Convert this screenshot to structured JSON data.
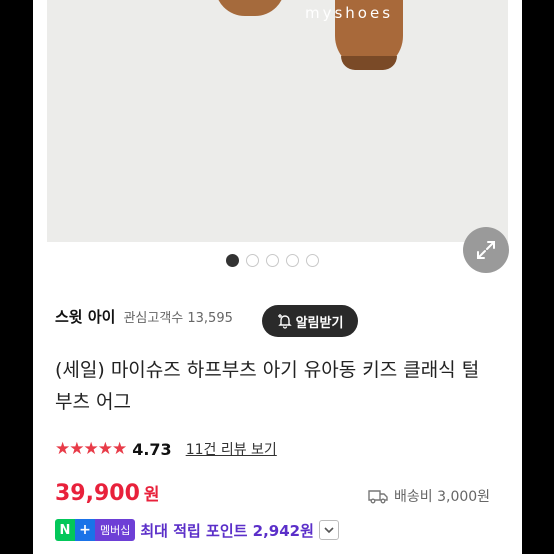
{
  "hero": {
    "watermark": "myshoes",
    "carousel_count": 5,
    "carousel_active": 0
  },
  "seller": {
    "name": "스윗 아이",
    "watchers": "관심고객수 13,595",
    "notify_label": "알림받기"
  },
  "product": {
    "title": "(세일) 마이슈즈 하프부츠 아기 유아동 키즈 클래식 털 부츠 어그",
    "stars": "★★★★★",
    "rating": "4.73",
    "reviews_link": "11건 리뷰 보기",
    "price": "39,900",
    "price_unit": "원",
    "shipping": "배송비 3,000원"
  },
  "points": {
    "n_badge": "N",
    "plus_badge": "+",
    "membership_badge": "멤버십",
    "text": "최대 적립 포인트 2,942원"
  },
  "colors": {
    "accent_red": "#e8213b",
    "star_red": "#e83b48",
    "naver_green": "#03c75a",
    "membership_purple": "#5b2fc9"
  },
  "icons": [
    "expand-icon",
    "bell-plus-icon",
    "truck-icon",
    "chevron-down-icon"
  ]
}
